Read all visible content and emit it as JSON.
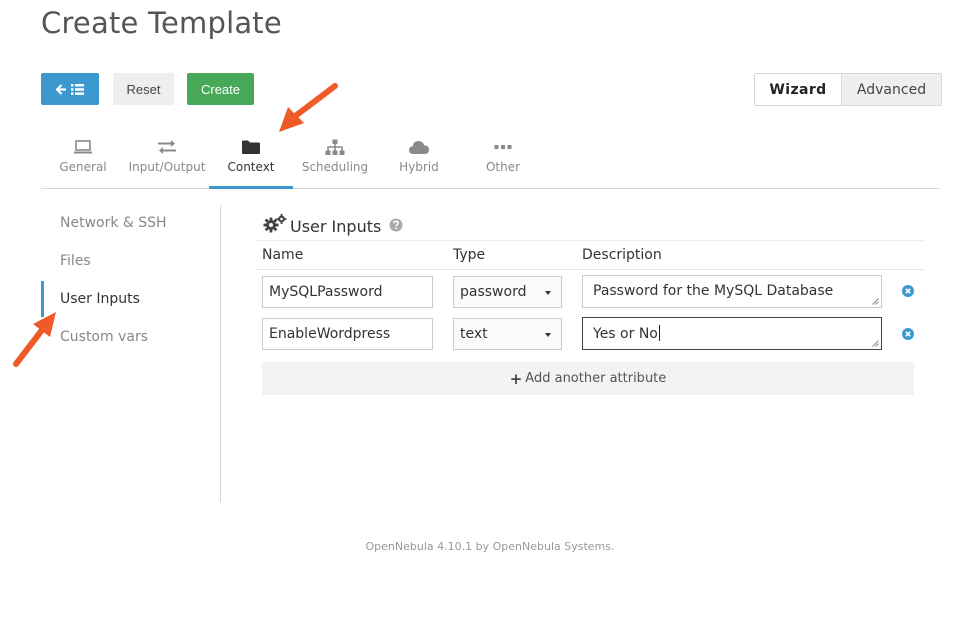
{
  "page": {
    "title": "Create Template"
  },
  "toolbar": {
    "reset_label": "Reset",
    "create_label": "Create"
  },
  "mode": {
    "wizard_label": "Wizard",
    "advanced_label": "Advanced",
    "selected": "Wizard"
  },
  "tabs": [
    {
      "label": "General",
      "icon": "laptop-icon"
    },
    {
      "label": "Input/Output",
      "icon": "exchange-icon"
    },
    {
      "label": "Context",
      "icon": "folder-icon",
      "active": true
    },
    {
      "label": "Scheduling",
      "icon": "sitemap-icon"
    },
    {
      "label": "Hybrid",
      "icon": "cloud-icon"
    },
    {
      "label": "Other",
      "icon": "ellipsis-icon"
    }
  ],
  "sidenav": {
    "items": [
      {
        "label": "Network & SSH"
      },
      {
        "label": "Files"
      },
      {
        "label": "User Inputs",
        "active": true
      },
      {
        "label": "Custom vars"
      }
    ]
  },
  "section": {
    "title": "User Inputs"
  },
  "table": {
    "headers": {
      "name": "Name",
      "type": "Type",
      "description": "Description"
    },
    "rows": [
      {
        "name": "MySQLPassword",
        "type": "password",
        "description": "Password for the MySQL Database"
      },
      {
        "name": "EnableWordpress",
        "type": "text",
        "description": "Yes or No"
      }
    ],
    "add_label": "Add another attribute"
  },
  "footer": {
    "text": "OpenNebula 4.10.1 by OpenNebula Systems."
  },
  "colors": {
    "primary": "#3b99d0",
    "success": "#47a957",
    "annotation_arrow": "#f05a28"
  }
}
